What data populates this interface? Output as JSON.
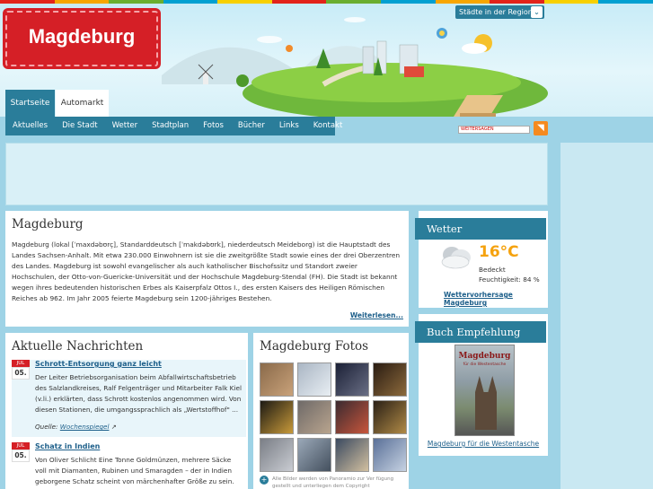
{
  "header": {
    "logo_text": "Magdeburg",
    "region_dropdown": "Städte in der Region",
    "tabs": [
      "Startseite",
      "Automarkt"
    ],
    "stripe_colors": [
      "#e2231a",
      "#f7a600",
      "#6aae2f",
      "#00a0d1",
      "#f7d000",
      "#e2231a",
      "#6aae2f",
      "#00a0d1",
      "#f7a600",
      "#e2231a",
      "#f7d000",
      "#00a0d1"
    ]
  },
  "nav": [
    "Aktuelles",
    "Die Stadt",
    "Wetter",
    "Stadtplan",
    "Fotos",
    "Bücher",
    "Links",
    "Kontakt"
  ],
  "share_label": "WEITERSAGEN",
  "intro": {
    "title": "Magdeburg",
    "text": "Magdeburg (lokal [ˈmaxdəbʊrç], Standarddeutsch [ˈmakdəbʊrk], niederdeutsch Meideborg) ist die Hauptstadt des Landes Sachsen-Anhalt. Mit etwa 230.000 Einwohnern ist sie die zweitgrößte Stadt sowie eines der drei Oberzentren des Landes. Magdeburg ist sowohl evangelischer als auch katholischer Bischofssitz und Standort zweier Hochschulen, der Otto-von-Guericke-Universität und der Hochschule Magdeburg-Stendal (FH). Die Stadt ist bekannt wegen ihres bedeutenden historischen Erbes als Kaiserpfalz Ottos I., des ersten Kaisers des Heiligen Römischen Reiches ab 962. Im Jahr 2005 feierte Magdeburg sein 1200-jähriges Bestehen.",
    "more": "Weiterlesen..."
  },
  "news": {
    "title": "Aktuelle Nachrichten",
    "items": [
      {
        "month": "JUL",
        "day": "05.",
        "title": "Schrott-Entsorgung ganz leicht",
        "body": "Der Leiter Betriebsorganisation beim Abfallwirtschaftsbetrieb des Salzlandkreises, Ralf Felgenträger und Mitarbeiter Falk Kiel (v.li.) erklärten, dass Schrott kostenlos angenommen wird. Von diesen Stationen, die umgangssprachlich als „Wertstoffhof\" ...",
        "source_label": "Quelle:",
        "source": "Wochenspiegel"
      },
      {
        "month": "JUL",
        "day": "05.",
        "title": "Schatz in Indien",
        "body": "Von Oliver Schlicht Eine Tonne Goldmünzen, mehrere Säcke voll mit Diamanten, Rubinen und Smaragden – der in Indien geborgene Schatz scheint von märchenhafter Größe zu sein."
      }
    ]
  },
  "fotos": {
    "title": "Magdeburg Fotos",
    "thumb_colors": [
      [
        "#8a6a4a",
        "#c9a27a"
      ],
      [
        "#aab6c4",
        "#e8eef3"
      ],
      [
        "#1b2036",
        "#6a6f85"
      ],
      [
        "#2a1c12",
        "#8c6a3c"
      ],
      [
        "#1c1a14",
        "#c89a3a"
      ],
      [
        "#6f6a68",
        "#b8a48e"
      ],
      [
        "#3a2a30",
        "#c8563c"
      ],
      [
        "#2a2016",
        "#b08a46"
      ],
      [
        "#7a7e86",
        "#c9ccd2"
      ],
      [
        "#9aa8b8",
        "#44505e"
      ],
      [
        "#3b4a60",
        "#d2c0a0"
      ],
      [
        "#5a7098",
        "#c6d2e2"
      ]
    ],
    "panoramio_note": "Alle Bilder werden von Panoramio zur Ver fügung gestellt und unterliegen dem Copyright"
  },
  "weather": {
    "title": "Wetter",
    "temp": "16°C",
    "condition": "Bedeckt",
    "humidity": "Feuchtigkeit: 84 %",
    "link": "Wettervorhersage Magdeburg",
    "icon": "cloud-icon"
  },
  "book": {
    "title": "Buch Empfehlung",
    "cover_title": "Magdeburg",
    "cover_subtitle": "für die Westentasche",
    "link": "Magdeburg für die Westentasche"
  }
}
